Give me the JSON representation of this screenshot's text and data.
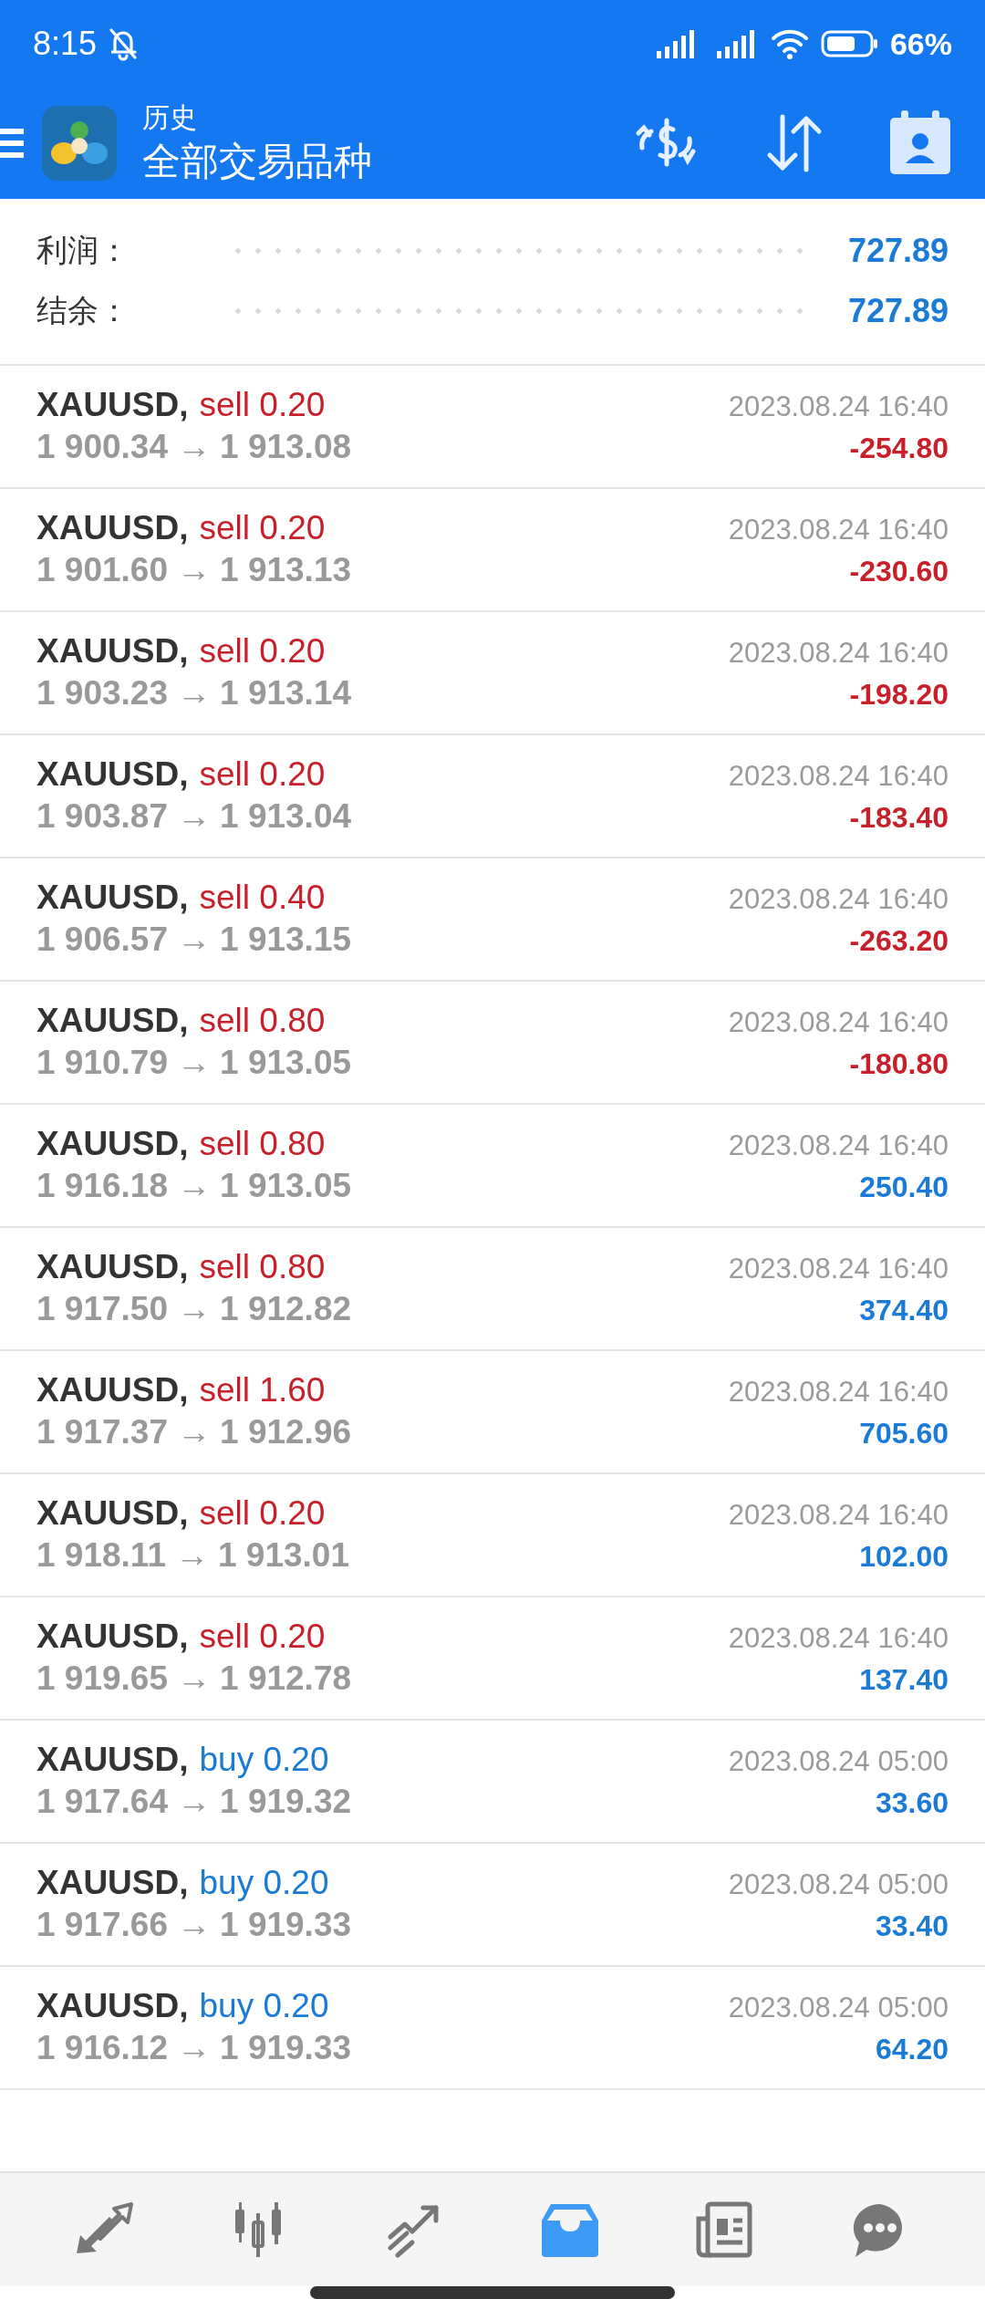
{
  "status_bar": {
    "time": "8:15",
    "battery": "66%"
  },
  "app_bar": {
    "title": "历史",
    "subtitle": "全部交易品种"
  },
  "summary": [
    {
      "label": "利润：",
      "value": "727.89"
    },
    {
      "label": "结余：",
      "value": "727.89"
    }
  ],
  "trades": [
    {
      "symbol": "XAUUSD,",
      "order": {
        "kind": "sell",
        "text": "sell 0.20"
      },
      "open": "1 900.34",
      "arrow": "→",
      "close": "1 913.08",
      "time": "2023.08.24 16:40",
      "profit": {
        "kind": "loss",
        "text": "-254.80"
      }
    },
    {
      "symbol": "XAUUSD,",
      "order": {
        "kind": "sell",
        "text": "sell 0.20"
      },
      "open": "1 901.60",
      "arrow": "→",
      "close": "1 913.13",
      "time": "2023.08.24 16:40",
      "profit": {
        "kind": "loss",
        "text": "-230.60"
      }
    },
    {
      "symbol": "XAUUSD,",
      "order": {
        "kind": "sell",
        "text": "sell 0.20"
      },
      "open": "1 903.23",
      "arrow": "→",
      "close": "1 913.14",
      "time": "2023.08.24 16:40",
      "profit": {
        "kind": "loss",
        "text": "-198.20"
      }
    },
    {
      "symbol": "XAUUSD,",
      "order": {
        "kind": "sell",
        "text": "sell 0.20"
      },
      "open": "1 903.87",
      "arrow": "→",
      "close": "1 913.04",
      "time": "2023.08.24 16:40",
      "profit": {
        "kind": "loss",
        "text": "-183.40"
      }
    },
    {
      "symbol": "XAUUSD,",
      "order": {
        "kind": "sell",
        "text": "sell 0.40"
      },
      "open": "1 906.57",
      "arrow": "→",
      "close": "1 913.15",
      "time": "2023.08.24 16:40",
      "profit": {
        "kind": "loss",
        "text": "-263.20"
      }
    },
    {
      "symbol": "XAUUSD,",
      "order": {
        "kind": "sell",
        "text": "sell 0.80"
      },
      "open": "1 910.79",
      "arrow": "→",
      "close": "1 913.05",
      "time": "2023.08.24 16:40",
      "profit": {
        "kind": "loss",
        "text": "-180.80"
      }
    },
    {
      "symbol": "XAUUSD,",
      "order": {
        "kind": "sell",
        "text": "sell 0.80"
      },
      "open": "1 916.18",
      "arrow": "→",
      "close": "1 913.05",
      "time": "2023.08.24 16:40",
      "profit": {
        "kind": "gain",
        "text": "250.40"
      }
    },
    {
      "symbol": "XAUUSD,",
      "order": {
        "kind": "sell",
        "text": "sell 0.80"
      },
      "open": "1 917.50",
      "arrow": "→",
      "close": "1 912.82",
      "time": "2023.08.24 16:40",
      "profit": {
        "kind": "gain",
        "text": "374.40"
      }
    },
    {
      "symbol": "XAUUSD,",
      "order": {
        "kind": "sell",
        "text": "sell 1.60"
      },
      "open": "1 917.37",
      "arrow": "→",
      "close": "1 912.96",
      "time": "2023.08.24 16:40",
      "profit": {
        "kind": "gain",
        "text": "705.60"
      }
    },
    {
      "symbol": "XAUUSD,",
      "order": {
        "kind": "sell",
        "text": "sell 0.20"
      },
      "open": "1 918.11",
      "arrow": "→",
      "close": "1 913.01",
      "time": "2023.08.24 16:40",
      "profit": {
        "kind": "gain",
        "text": "102.00"
      }
    },
    {
      "symbol": "XAUUSD,",
      "order": {
        "kind": "sell",
        "text": "sell 0.20"
      },
      "open": "1 919.65",
      "arrow": "→",
      "close": "1 912.78",
      "time": "2023.08.24 16:40",
      "profit": {
        "kind": "gain",
        "text": "137.40"
      }
    },
    {
      "symbol": "XAUUSD,",
      "order": {
        "kind": "buy",
        "text": "buy 0.20"
      },
      "open": "1 917.64",
      "arrow": "→",
      "close": "1 919.32",
      "time": "2023.08.24 05:00",
      "profit": {
        "kind": "gain",
        "text": "33.60"
      }
    },
    {
      "symbol": "XAUUSD,",
      "order": {
        "kind": "buy",
        "text": "buy 0.20"
      },
      "open": "1 917.66",
      "arrow": "→",
      "close": "1 919.33",
      "time": "2023.08.24 05:00",
      "profit": {
        "kind": "gain",
        "text": "33.40"
      }
    },
    {
      "symbol": "XAUUSD,",
      "order": {
        "kind": "buy",
        "text": "buy 0.20"
      },
      "open": "1 916.12",
      "arrow": "→",
      "close": "1 919.33",
      "time": "2023.08.24 05:00",
      "profit": {
        "kind": "gain",
        "text": "64.20"
      }
    }
  ],
  "nav": [
    {
      "selected": false
    },
    {
      "selected": false
    },
    {
      "selected": false
    },
    {
      "selected": true
    },
    {
      "selected": false
    },
    {
      "selected": false
    }
  ]
}
